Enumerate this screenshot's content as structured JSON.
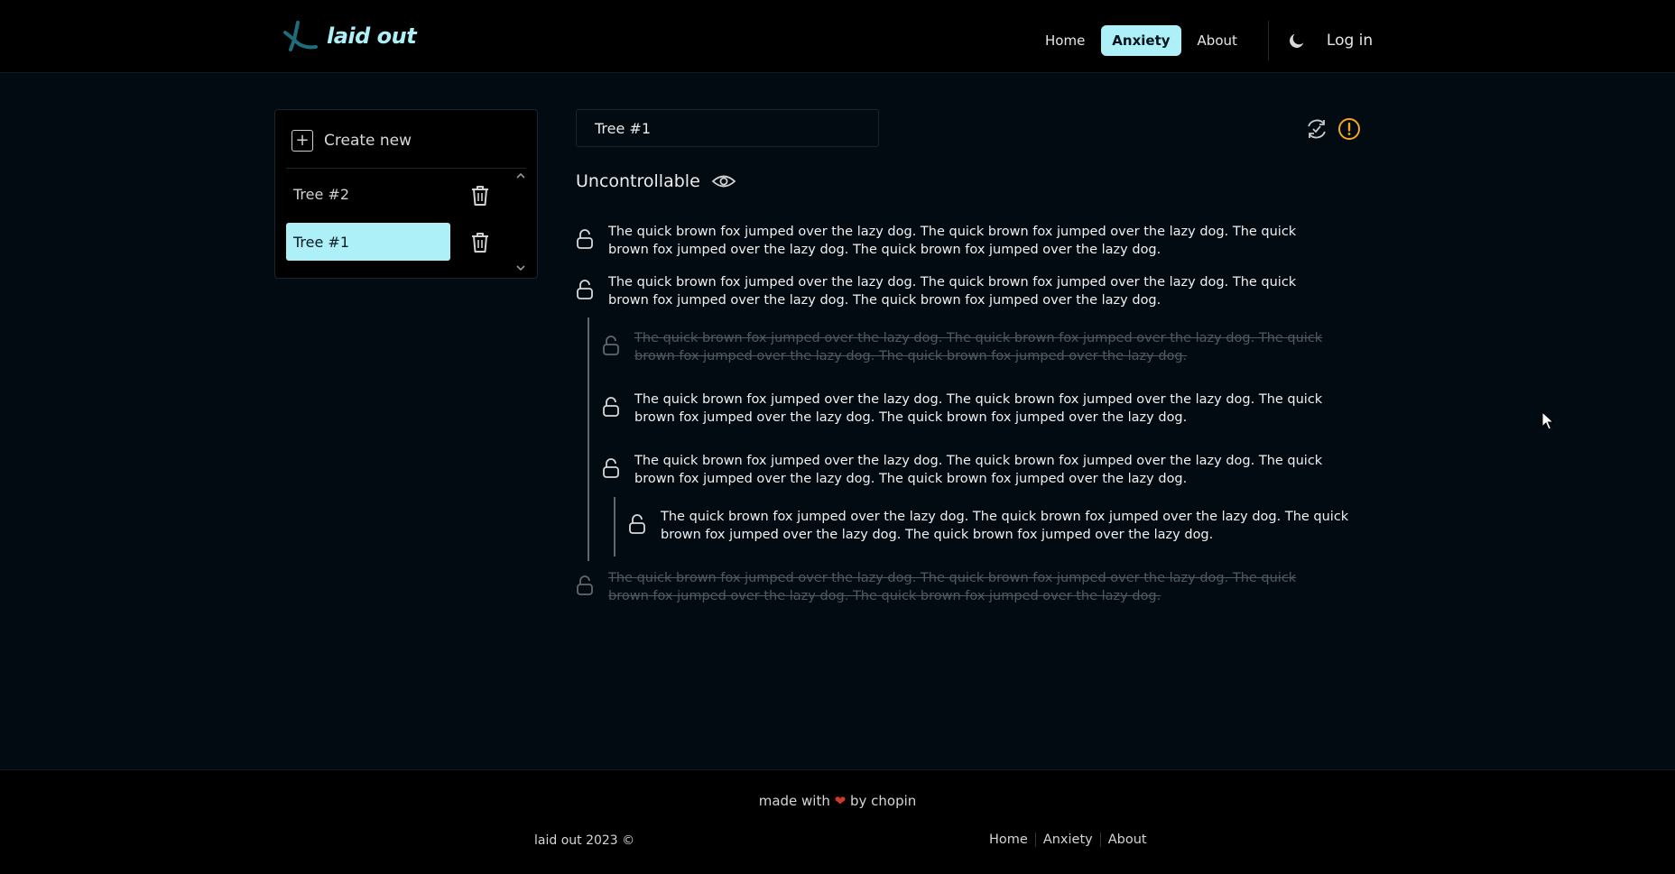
{
  "header": {
    "logo_text": "laid out",
    "nav": [
      {
        "label": "Home"
      },
      {
        "label": "Anxiety"
      },
      {
        "label": "About"
      }
    ],
    "login_label": "Log in"
  },
  "sidebar": {
    "create_label": "Create new",
    "trees": [
      {
        "label": "Tree #2"
      },
      {
        "label": "Tree #1"
      }
    ]
  },
  "main": {
    "tree_title": "Tree #1",
    "section_heading": "Uncontrollable",
    "entries": [
      {
        "text": "The quick brown fox jumped over the lazy dog. The quick brown fox jumped over the lazy dog. The quick brown fox jumped over the lazy dog. The quick brown fox jumped over the lazy dog.",
        "done": false
      },
      {
        "text": "The quick brown fox jumped over the lazy dog. The quick brown fox jumped over the lazy dog. The quick brown fox jumped over the lazy dog. The quick brown fox jumped over the lazy dog.",
        "done": false
      },
      {
        "text": "The quick brown fox jumped over the lazy dog. The quick brown fox jumped over the lazy dog. The quick brown fox jumped over the lazy dog. The quick brown fox jumped over the lazy dog.",
        "done": true
      },
      {
        "text": "The quick brown fox jumped over the lazy dog. The quick brown fox jumped over the lazy dog. The quick brown fox jumped over the lazy dog. The quick brown fox jumped over the lazy dog.",
        "done": false
      },
      {
        "text": "The quick brown fox jumped over the lazy dog. The quick brown fox jumped over the lazy dog. The quick brown fox jumped over the lazy dog. The quick brown fox jumped over the lazy dog.",
        "done": false
      },
      {
        "text": "The quick brown fox jumped over the lazy dog. The quick brown fox jumped over the lazy dog. The quick brown fox jumped over the lazy dog. The quick brown fox jumped over the lazy dog.",
        "done": false
      },
      {
        "text": "The quick brown fox jumped over the lazy dog. The quick brown fox jumped over the lazy dog. The quick brown fox jumped over the lazy dog. The quick brown fox jumped over the lazy dog.",
        "done": true
      }
    ]
  },
  "footer": {
    "made_with_prefix": "made with",
    "heart": "❤",
    "made_with_suffix": "by chopin",
    "copyright": "laid out 2023 ©",
    "nav": [
      {
        "label": "Home"
      },
      {
        "label": "Anxiety"
      },
      {
        "label": "About"
      }
    ]
  },
  "colors": {
    "accent": "#aef0f8",
    "background": "#030b12",
    "header_bg": "#000000",
    "warning": "#f5a623",
    "heart": "#d0392b"
  }
}
